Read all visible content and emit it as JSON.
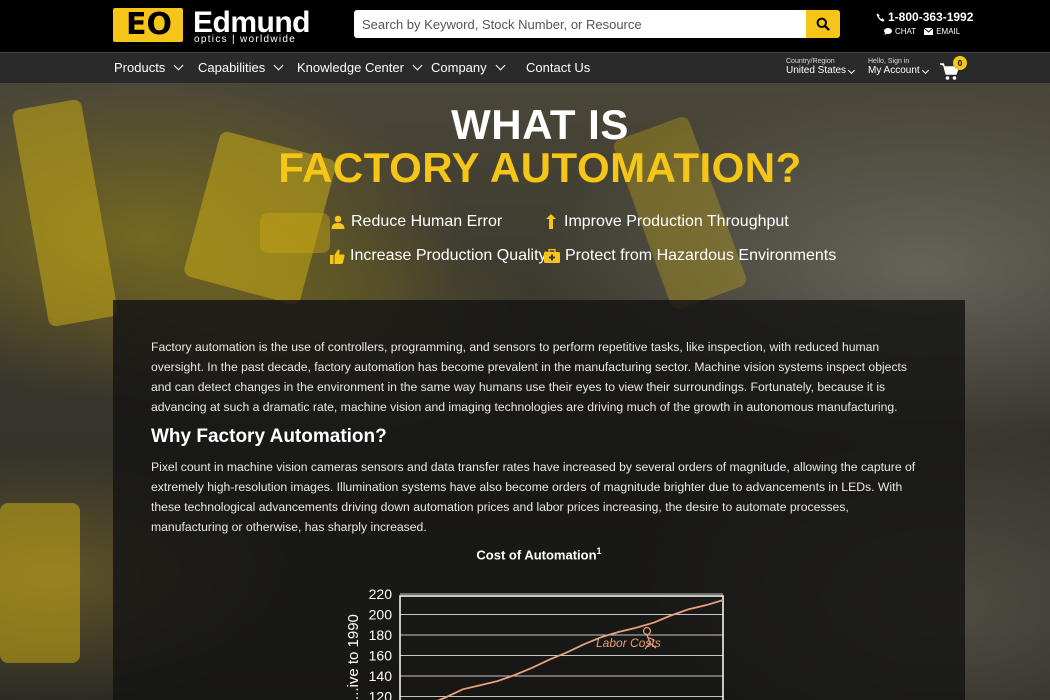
{
  "header": {
    "logo_text": "Edmund",
    "logo_sub": "optics | worldwide",
    "search_placeholder": "Search by Keyword, Stock Number, or Resource",
    "phone": "1-800-363-1992",
    "chat": "CHAT",
    "email": "EMAIL"
  },
  "nav": {
    "items": [
      {
        "label": "Products"
      },
      {
        "label": "Capabilities"
      },
      {
        "label": "Knowledge Center"
      },
      {
        "label": "Company"
      },
      {
        "label": "Contact Us"
      }
    ],
    "region_label": "Country/Region",
    "region_value": "United States",
    "account_label": "Hello, Sign in",
    "account_value": "My Account",
    "cart_count": "0"
  },
  "hero": {
    "title_line1": "WHAT IS",
    "title_line2": "FACTORY AUTOMATION?",
    "benefits": [
      {
        "label": "Reduce Human Error",
        "icon": "user-icon"
      },
      {
        "label": "Improve Production Throughput",
        "icon": "arrow-up-icon"
      },
      {
        "label": "Increase Production Quality",
        "icon": "thumbs-up-icon"
      },
      {
        "label": "Protect from Hazardous Environments",
        "icon": "medkit-icon"
      }
    ]
  },
  "content": {
    "intro": "Factory automation is the use of controllers, programming, and sensors to perform repetitive tasks, like inspection, with reduced human oversight. In the past decade, factory automation has become prevalent in the manufacturing sector. Machine vision systems inspect objects and can detect changes in the environment in the same way humans use their eyes to view their surroundings. Fortunately, because it is advancing at such a dramatic rate, machine vision and imaging technologies are driving much of the growth in autonomous manufacturing.",
    "heading": "Why Factory Automation?",
    "body": "Pixel count in machine vision cameras sensors and data transfer rates have increased by several orders of magnitude, allowing the capture of extremely high-resolution images. Illumination systems have also become orders of magnitude brighter due to advancements in LEDs. With these technological advancements driving down automation prices and labor prices increasing, the desire to automate processes, manufacturing or otherwise, has sharply increased.",
    "chart_title": "Cost of Automation",
    "chart_title_sup": "1"
  },
  "chart_data": {
    "type": "line",
    "title": "Cost of Automation",
    "ylabel": "...ive to 1990",
    "yticks": [
      120,
      140,
      160,
      180,
      200,
      220
    ],
    "ylim": [
      110,
      222
    ],
    "annotations": [
      "Labor Costs"
    ],
    "series": [
      {
        "name": "Labor Costs",
        "x": [
          0,
          1,
          2,
          3,
          4,
          5,
          6,
          7,
          8,
          9,
          10,
          11,
          12,
          13,
          14,
          15,
          16,
          17
        ],
        "values": [
          112,
          119,
          127,
          131,
          135,
          141,
          148,
          156,
          163,
          171,
          178,
          183,
          187,
          192,
          199,
          205,
          209,
          214
        ]
      }
    ],
    "colors": {
      "line": "#e8a07a",
      "grid": "#ffffff"
    }
  }
}
